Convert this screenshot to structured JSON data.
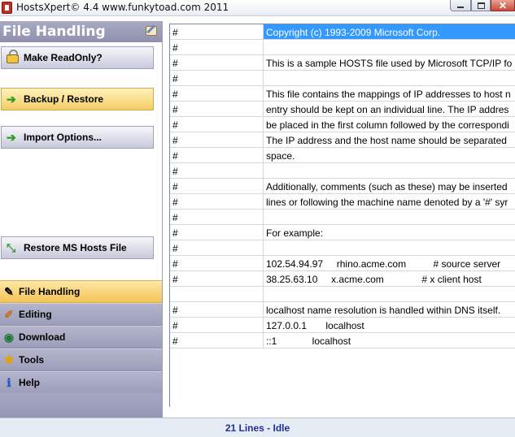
{
  "window": {
    "title": "HostsXpert© 4.4  www.funkytoad.com 2011"
  },
  "panel": {
    "title": "File Handling",
    "actions": [
      {
        "label": "Make ReadOnly?",
        "icon": "lock-icon"
      },
      {
        "label": "Backup / Restore",
        "icon": "arrow-right-icon"
      },
      {
        "label": "Import Options...",
        "icon": "arrow-right-icon"
      },
      {
        "label": "Restore MS Hosts File",
        "icon": "restore-icon"
      }
    ]
  },
  "nav": {
    "items": [
      {
        "label": "File Handling",
        "icon": "file-handling-icon"
      },
      {
        "label": "Editing",
        "icon": "pencil-icon"
      },
      {
        "label": "Download",
        "icon": "globe-icon"
      },
      {
        "label": "Tools",
        "icon": "tools-icon"
      },
      {
        "label": "Help",
        "icon": "help-icon"
      }
    ]
  },
  "grid": {
    "rows": [
      {
        "hash": "#",
        "text": "Copyright (c) 1993-2009 Microsoft Corp."
      },
      {
        "hash": "#",
        "text": ""
      },
      {
        "hash": "#",
        "text": "This is a sample HOSTS file used by Microsoft TCP/IP fo"
      },
      {
        "hash": "#",
        "text": ""
      },
      {
        "hash": "#",
        "text": "This file contains the mappings of IP addresses to host n"
      },
      {
        "hash": "#",
        "text": "entry should be kept on an individual line. The IP addres"
      },
      {
        "hash": "#",
        "text": "be placed in the first column followed by the correspondi"
      },
      {
        "hash": "#",
        "text": "The IP address and the host name should be separated"
      },
      {
        "hash": "#",
        "text": "space."
      },
      {
        "hash": "#",
        "text": ""
      },
      {
        "hash": "#",
        "text": "Additionally, comments (such as these) may be inserted"
      },
      {
        "hash": "#",
        "text": "lines or following the machine name denoted by a '#' syr"
      },
      {
        "hash": "#",
        "text": ""
      },
      {
        "hash": "#",
        "text": "For example:"
      },
      {
        "hash": "#",
        "text": ""
      },
      {
        "hash": "#",
        "text": "102.54.94.97     rhino.acme.com          # source server"
      },
      {
        "hash": "#",
        "text": "38.25.63.10     x.acme.com              # x client host"
      },
      {
        "hash": "",
        "text": ""
      },
      {
        "hash": "#",
        "text": "localhost name resolution is handled within DNS itself."
      },
      {
        "hash": "#",
        "text": "127.0.0.1       localhost"
      },
      {
        "hash": "#",
        "text": "::1             localhost"
      }
    ]
  },
  "status": {
    "text": "21 Lines - Idle"
  },
  "colors": {
    "selection": "#3399ff",
    "status_text": "#1f2f9e",
    "active_gold": "#f4c357"
  }
}
